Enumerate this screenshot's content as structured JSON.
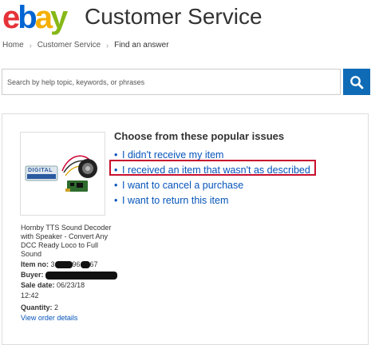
{
  "header": {
    "logo_e": "e",
    "logo_b": "b",
    "logo_a": "a",
    "logo_y": "y",
    "title": "Customer Service"
  },
  "breadcrumb": {
    "items": [
      "Home",
      "Customer Service",
      "Find an answer"
    ]
  },
  "search": {
    "placeholder": "Search by help topic, keywords, or phrases"
  },
  "issues": {
    "title": "Choose from these popular issues",
    "items": [
      "I didn't receive my item",
      "I received an item that wasn't as described",
      "I want to cancel a purchase",
      "I want to return this item"
    ]
  },
  "item": {
    "title": "Hornby TTS Sound Decoder with Speaker - Convert Any DCC Ready Loco to Full Sound",
    "item_no_label": "Item no:",
    "item_no_start": "3",
    "item_no_mid": "96",
    "item_no_end": "67",
    "buyer_label": "Buyer:",
    "sale_date_label": "Sale date:",
    "sale_date": "06/23/18",
    "sale_time": "12:42",
    "quantity_label": "Quantity:",
    "quantity": "2",
    "view_order": "View order details",
    "product_badge": "DIGITAL"
  },
  "colors": {
    "accent": "#0f6bb6",
    "link": "#0654ba",
    "highlight": "#c8102e"
  }
}
